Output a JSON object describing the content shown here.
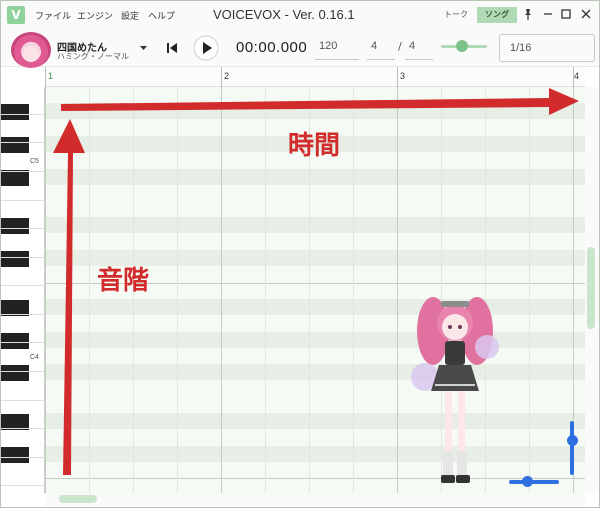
{
  "titlebar": {
    "logo": "V",
    "menus": [
      "ファイル",
      "エンジン",
      "設定",
      "ヘルプ"
    ],
    "title": "VOICEVOX - Ver. 0.16.1",
    "mode_talk": "トーク",
    "mode_song": "ソング",
    "controls": [
      "pin-icon",
      "minimize-icon",
      "maximize-icon",
      "close-icon"
    ]
  },
  "toolbar": {
    "character_name": "四国めたん",
    "character_style": "ハミング・ノーマル",
    "time": "00:00.000",
    "tempo": "120",
    "beats": "4",
    "beat_type": "4",
    "slash": "/",
    "snap": "1/16",
    "volume_level": 0.45
  },
  "ruler": {
    "measures": [
      "1",
      "2",
      "3",
      "4"
    ]
  },
  "keyboard": {
    "labels": [
      "C5",
      "C4"
    ]
  },
  "annotations": {
    "time_label": "時間",
    "pitch_label": "音階"
  },
  "colors": {
    "accent": "#7cc08a",
    "arrow": "#d22b2b",
    "zoom": "#2f6fe0"
  }
}
